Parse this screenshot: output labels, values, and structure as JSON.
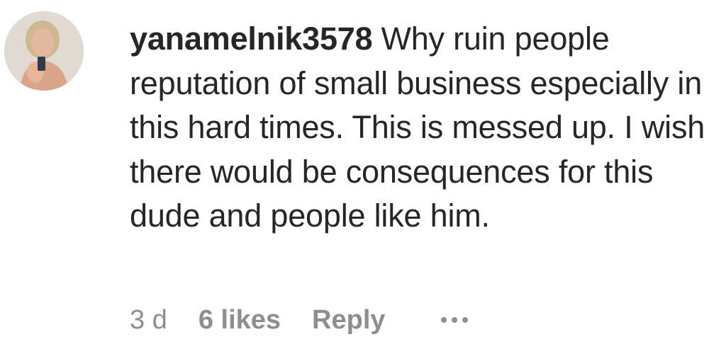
{
  "comment": {
    "username": "yanamelnik3578",
    "text": "Why ruin people reputation of small business especially in this hard times. This is messed up. I wish there would be consequences for this dude and people like him.",
    "time": "3 d",
    "likes": "6 likes",
    "reply_label": "Reply",
    "more_icon": "more-options-icon"
  },
  "colors": {
    "text": "#262626",
    "secondary": "#8e8e8e",
    "background": "#ffffff"
  }
}
